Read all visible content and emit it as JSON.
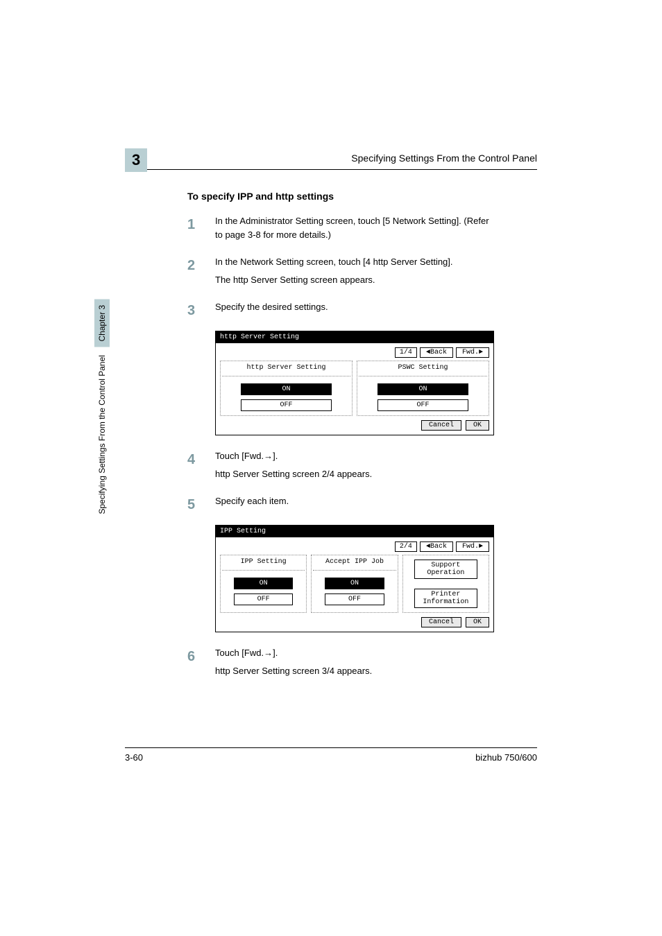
{
  "header": {
    "chapter_num": "3",
    "running_title": "Specifying Settings From the Control Panel"
  },
  "side": {
    "chapter_label": "Chapter 3",
    "section_title": "Specifying Settings From the Control Panel"
  },
  "section_heading": "To specify IPP and http settings",
  "steps": {
    "s1": {
      "num": "1",
      "l1": "In the Administrator Setting screen, touch [5 Network Setting]. (Refer to page 3-8 for more details.)"
    },
    "s2": {
      "num": "2",
      "l1": "In the Network Setting screen, touch [4 http Server Setting].",
      "l2": "The http Server Setting screen appears."
    },
    "s3": {
      "num": "3",
      "l1": "Specify the desired settings."
    },
    "s4": {
      "num": "4",
      "l1": "Touch [Fwd.→].",
      "l2": "http Server Setting screen 2/4 appears."
    },
    "s5": {
      "num": "5",
      "l1": "Specify each item."
    },
    "s6": {
      "num": "6",
      "l1": "Touch [Fwd.→].",
      "l2": "http Server Setting screen 3/4 appears."
    }
  },
  "panel1": {
    "title": "http Server Setting",
    "page": "1/4",
    "back": "Back",
    "fwd": "Fwd.",
    "col1_h": "http Server Setting",
    "col2_h": "PSWC Setting",
    "on": "ON",
    "off": "OFF",
    "cancel": "Cancel",
    "ok": "OK"
  },
  "panel2": {
    "title": "IPP Setting",
    "page": "2/4",
    "back": "Back",
    "fwd": "Fwd.",
    "col1_h": "IPP Setting",
    "col2_h": "Accept IPP Job",
    "on": "ON",
    "off": "OFF",
    "btn1": "Support Operation",
    "btn2": "Printer Information",
    "cancel": "Cancel",
    "ok": "OK"
  },
  "footer": {
    "page_num": "3-60",
    "model": "bizhub 750/600"
  }
}
